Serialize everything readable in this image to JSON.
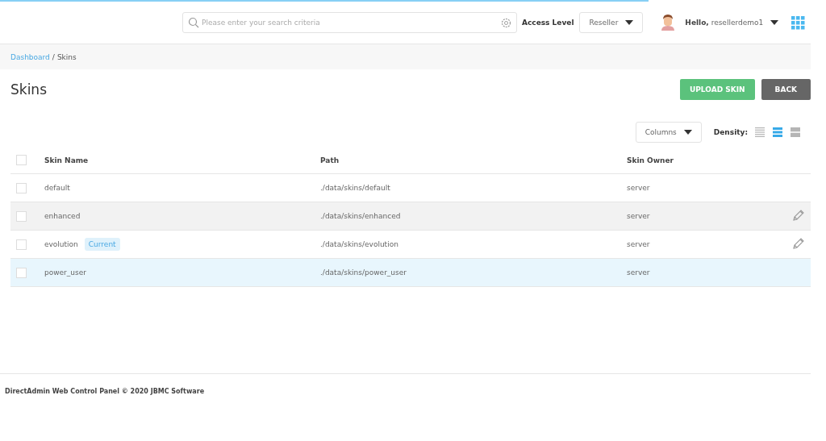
{
  "loading_bar": {
    "level": 0.8
  },
  "header": {
    "search": {
      "placeholder": "Please enter your search criteria"
    },
    "access_label": "Access Level",
    "access_value": "Reseller",
    "greeting": "Hello,",
    "username": "resellerdemo1"
  },
  "breadcrumb": [
    {
      "label": "Dashboard",
      "link": true
    },
    {
      "label": "Skins",
      "link": false
    }
  ],
  "breadcrumb_separator": "/",
  "title": "Skins",
  "buttons": [
    {
      "label": "UPLOAD SKIN",
      "kind": "primary"
    },
    {
      "label": "BACK",
      "kind": "secondary"
    }
  ],
  "columns_button": "Columns",
  "density": {
    "label": "Density:",
    "options": [
      {
        "kind": "compact",
        "selected": false
      },
      {
        "kind": "normal",
        "selected": true
      },
      {
        "kind": "wide",
        "selected": false
      }
    ]
  },
  "table": {
    "select_all": {
      "checked": false
    },
    "columns": [
      "Skin Name",
      "Path",
      "Skin Owner"
    ],
    "rows": [
      {
        "name": "default",
        "path": "./data/skins/default",
        "owner": "server",
        "checked": false,
        "hovered": false,
        "selected": false,
        "editable": false
      },
      {
        "name": "enhanced",
        "path": "./data/skins/enhanced",
        "owner": "server",
        "checked": false,
        "hovered": true,
        "selected": false,
        "editable": true
      },
      {
        "name": "evolution",
        "badge": "Current",
        "path": "./data/skins/evolution",
        "owner": "server",
        "checked": false,
        "hovered": false,
        "selected": false,
        "editable": true
      },
      {
        "name": "power_user",
        "path": "./data/skins/power_user",
        "owner": "server",
        "checked": false,
        "hovered": false,
        "selected": true,
        "editable": false
      }
    ]
  },
  "footer": "DirectAdmin Web Control Panel © 2020 JBMC Software"
}
